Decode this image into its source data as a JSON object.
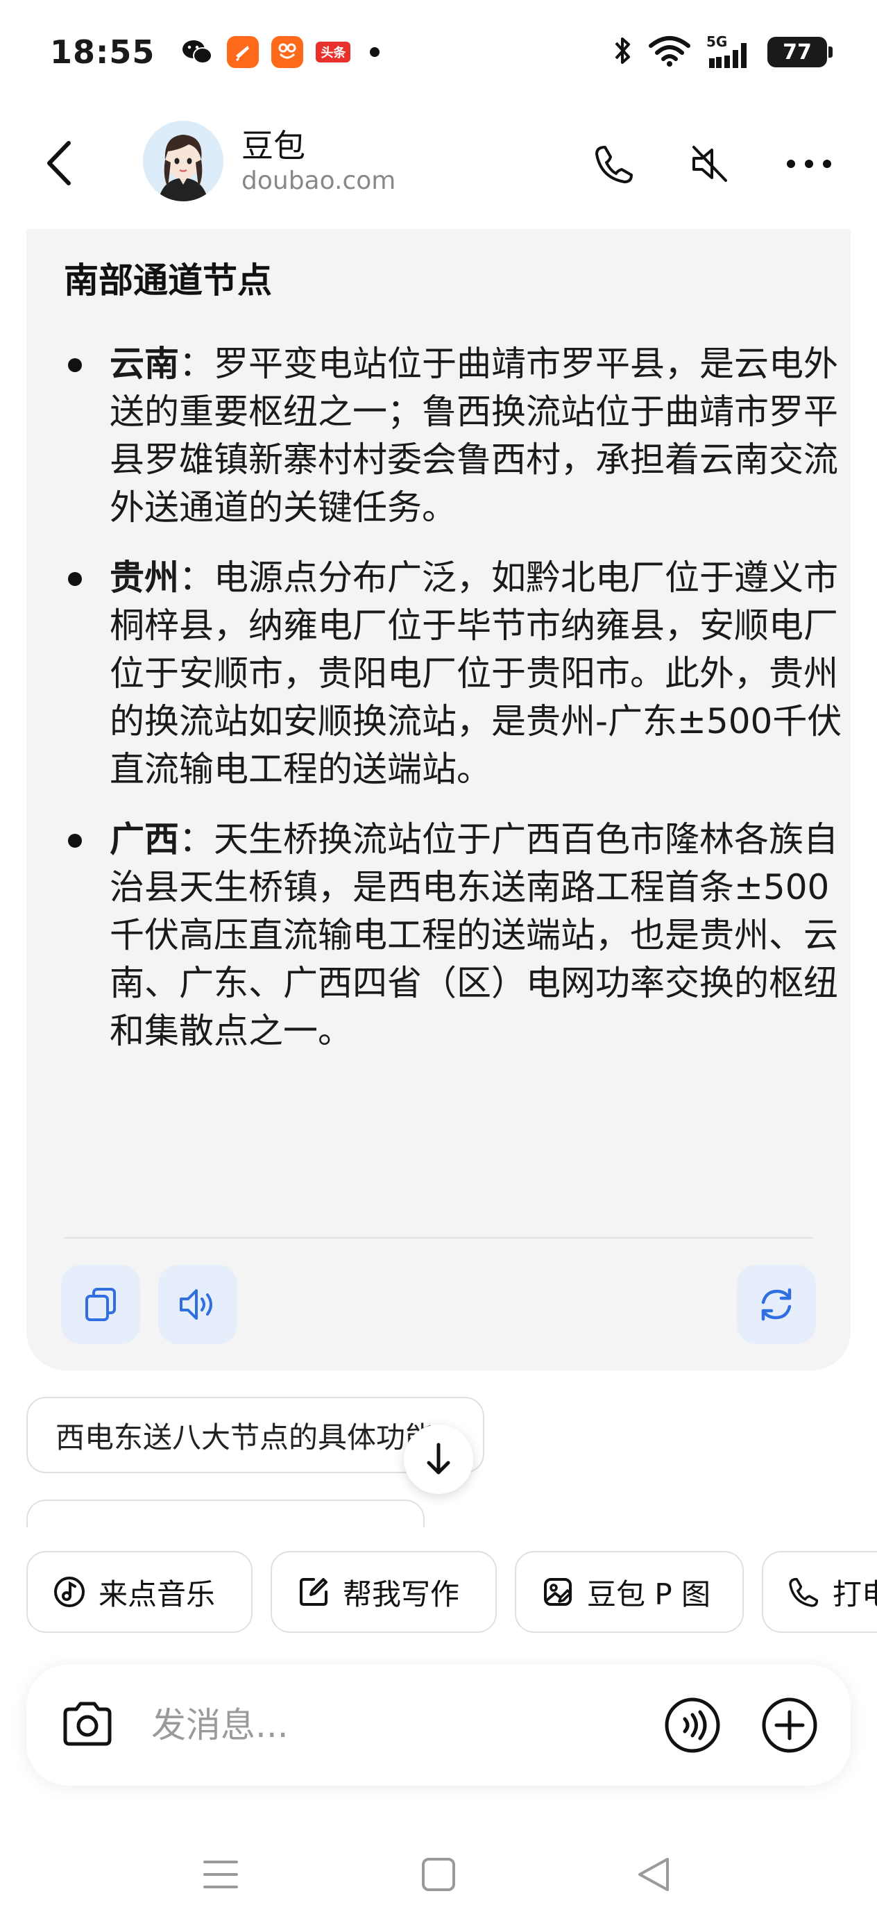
{
  "status_bar": {
    "time": "18:55",
    "apps": [
      "wechat-icon",
      "orange-app-icon",
      "orange-app2-icon",
      "toutiao-icon"
    ],
    "toutiao_label": "头条",
    "network": "5G",
    "battery": "77"
  },
  "header": {
    "title": "豆包",
    "subtitle": "doubao.com"
  },
  "answer": {
    "section_title": "南部通道节点",
    "items": [
      {
        "label": "云南",
        "text": "：罗平变电站位于曲靖市罗平县，是云电外送的重要枢纽之一；鲁西换流站位于曲靖市罗平县罗雄镇新寨村村委会鲁西村，承担着云南交流外送通道的关键任务。"
      },
      {
        "label": "贵州",
        "text": "：电源点分布广泛，如黔北电厂位于遵义市桐梓县，纳雍电厂位于毕节市纳雍县，安顺电厂位于安顺市，贵阳电厂位于贵阳市。此外，贵州的换流站如安顺换流站，是贵州-广东±500千伏直流输电工程的送端站。"
      },
      {
        "label": "广西",
        "text": "：天生桥换流站位于广西百色市隆林各族自治县天生桥镇，是西电东送南路工程首条±500千伏高压直流输电工程的送端站，也是贵州、云南、广东、广西四省（区）电网功率交换的枢纽和集散点之一。"
      }
    ]
  },
  "suggestion": "西电东送八大节点的具体功能",
  "quick_actions": [
    {
      "label": "来点音乐",
      "icon": "music-icon"
    },
    {
      "label": "帮我写作",
      "icon": "edit-icon"
    },
    {
      "label": "豆包 P 图",
      "icon": "image-edit-icon"
    },
    {
      "label": "打电话",
      "icon": "phone-icon"
    }
  ],
  "input": {
    "placeholder": "发消息..."
  },
  "colors": {
    "accent": "#2f6fe0",
    "card_bg": "#f4f4f4",
    "action_bg": "#e7eefb"
  }
}
